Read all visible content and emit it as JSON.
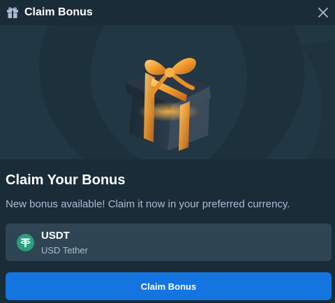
{
  "modal": {
    "title": "Claim Bonus",
    "gift_icon": "gift-icon",
    "close_icon": "close-icon"
  },
  "banner": {
    "image": "gift-box-illustration"
  },
  "content": {
    "heading": "Claim Your Bonus",
    "description": "New bonus available! Claim it now in your preferred currency."
  },
  "currency": {
    "icon": "tether-coin-icon",
    "code": "USDT",
    "name": "USD Tether",
    "color": "#26a17b"
  },
  "actions": {
    "claim_label": "Claim Bonus",
    "button_color": "#1475e1"
  }
}
